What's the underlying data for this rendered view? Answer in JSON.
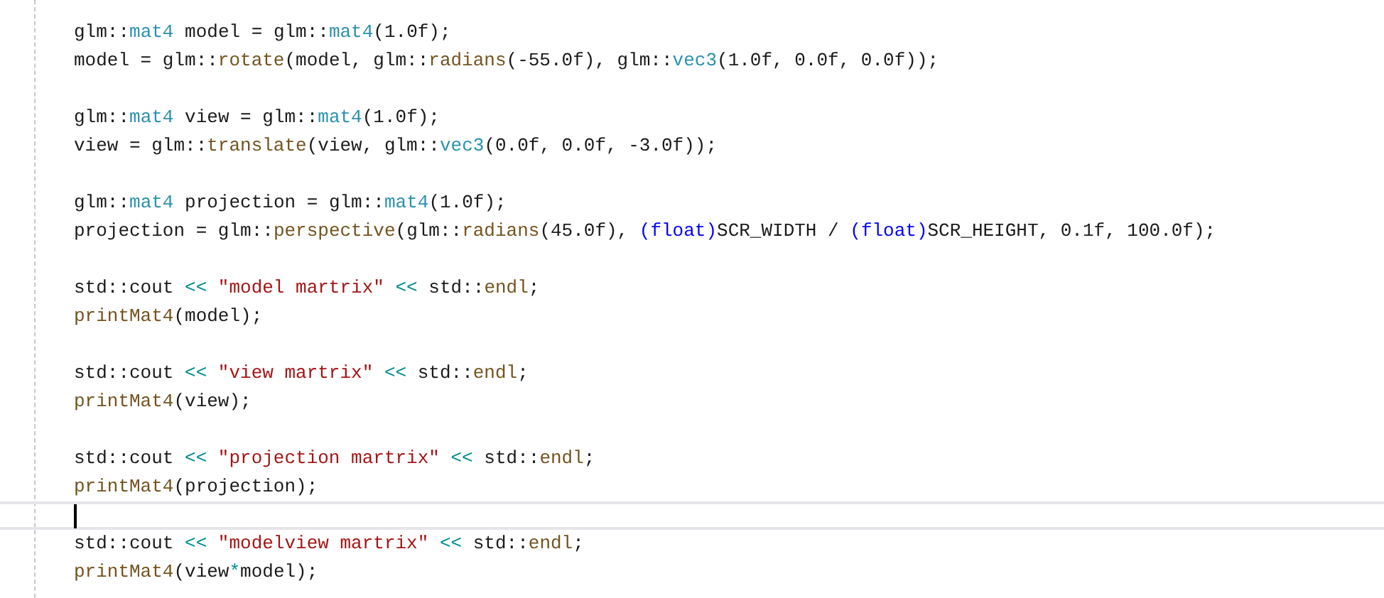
{
  "editor": {
    "lines": [
      {
        "current": false,
        "tokens": [
          {
            "kind": "plain",
            "text": "glm::"
          },
          {
            "kind": "type",
            "text": "mat4"
          },
          {
            "kind": "plain",
            "text": " model = glm::"
          },
          {
            "kind": "type",
            "text": "mat4"
          },
          {
            "kind": "plain",
            "text": "(1.0f);"
          }
        ]
      },
      {
        "current": false,
        "tokens": [
          {
            "kind": "plain",
            "text": "model = glm::"
          },
          {
            "kind": "func",
            "text": "rotate"
          },
          {
            "kind": "plain",
            "text": "(model, glm::"
          },
          {
            "kind": "func",
            "text": "radians"
          },
          {
            "kind": "plain",
            "text": "(-55.0f), glm::"
          },
          {
            "kind": "type",
            "text": "vec3"
          },
          {
            "kind": "plain",
            "text": "(1.0f, 0.0f, 0.0f));"
          }
        ]
      },
      {
        "current": false
      },
      {
        "current": false,
        "tokens": [
          {
            "kind": "plain",
            "text": "glm::"
          },
          {
            "kind": "type",
            "text": "mat4"
          },
          {
            "kind": "plain",
            "text": " view = glm::"
          },
          {
            "kind": "type",
            "text": "mat4"
          },
          {
            "kind": "plain",
            "text": "(1.0f);"
          }
        ]
      },
      {
        "current": false,
        "tokens": [
          {
            "kind": "plain",
            "text": "view = glm::"
          },
          {
            "kind": "func",
            "text": "translate"
          },
          {
            "kind": "plain",
            "text": "(view, glm::"
          },
          {
            "kind": "type",
            "text": "vec3"
          },
          {
            "kind": "plain",
            "text": "(0.0f, 0.0f, -3.0f));"
          }
        ]
      },
      {
        "current": false
      },
      {
        "current": false,
        "tokens": [
          {
            "kind": "plain",
            "text": "glm::"
          },
          {
            "kind": "type",
            "text": "mat4"
          },
          {
            "kind": "plain",
            "text": " projection = glm::"
          },
          {
            "kind": "type",
            "text": "mat4"
          },
          {
            "kind": "plain",
            "text": "(1.0f);"
          }
        ]
      },
      {
        "current": false,
        "tokens": [
          {
            "kind": "plain",
            "text": "projection = glm::"
          },
          {
            "kind": "func",
            "text": "perspective"
          },
          {
            "kind": "plain",
            "text": "(glm::"
          },
          {
            "kind": "func",
            "text": "radians"
          },
          {
            "kind": "plain",
            "text": "(45.0f), "
          },
          {
            "kind": "keyword",
            "text": "(float)"
          },
          {
            "kind": "plain",
            "text": "SCR_WIDTH / "
          },
          {
            "kind": "keyword",
            "text": "(float)"
          },
          {
            "kind": "plain",
            "text": "SCR_HEIGHT, 0.1f, 100.0f);"
          }
        ]
      },
      {
        "current": false
      },
      {
        "current": false,
        "tokens": [
          {
            "kind": "plain",
            "text": "std::cout "
          },
          {
            "kind": "operator",
            "text": "<< "
          },
          {
            "kind": "string",
            "text": "\"model martrix\""
          },
          {
            "kind": "operator",
            "text": " << "
          },
          {
            "kind": "plain",
            "text": "std::"
          },
          {
            "kind": "func",
            "text": "endl"
          },
          {
            "kind": "plain",
            "text": ";"
          }
        ]
      },
      {
        "current": false,
        "tokens": [
          {
            "kind": "func",
            "text": "printMat4"
          },
          {
            "kind": "plain",
            "text": "(model);"
          }
        ]
      },
      {
        "current": false
      },
      {
        "current": false,
        "tokens": [
          {
            "kind": "plain",
            "text": "std::cout "
          },
          {
            "kind": "operator",
            "text": "<< "
          },
          {
            "kind": "string",
            "text": "\"view martrix\""
          },
          {
            "kind": "operator",
            "text": " << "
          },
          {
            "kind": "plain",
            "text": "std::"
          },
          {
            "kind": "func",
            "text": "endl"
          },
          {
            "kind": "plain",
            "text": ";"
          }
        ]
      },
      {
        "current": false,
        "tokens": [
          {
            "kind": "func",
            "text": "printMat4"
          },
          {
            "kind": "plain",
            "text": "(view);"
          }
        ]
      },
      {
        "current": false
      },
      {
        "current": false,
        "tokens": [
          {
            "kind": "plain",
            "text": "std::cout "
          },
          {
            "kind": "operator",
            "text": "<< "
          },
          {
            "kind": "string",
            "text": "\"projection martrix\""
          },
          {
            "kind": "operator",
            "text": " << "
          },
          {
            "kind": "plain",
            "text": "std::"
          },
          {
            "kind": "func",
            "text": "endl"
          },
          {
            "kind": "plain",
            "text": ";"
          }
        ]
      },
      {
        "current": false,
        "tokens": [
          {
            "kind": "func",
            "text": "printMat4"
          },
          {
            "kind": "plain",
            "text": "(projection);"
          }
        ]
      },
      {
        "current": true
      },
      {
        "current": false,
        "tokens": [
          {
            "kind": "plain",
            "text": "std::cout "
          },
          {
            "kind": "operator",
            "text": "<< "
          },
          {
            "kind": "string",
            "text": "\"modelview martrix\""
          },
          {
            "kind": "operator",
            "text": " << "
          },
          {
            "kind": "plain",
            "text": "std::"
          },
          {
            "kind": "func",
            "text": "endl"
          },
          {
            "kind": "plain",
            "text": ";"
          }
        ]
      },
      {
        "current": false,
        "tokens": [
          {
            "kind": "func",
            "text": "printMat4"
          },
          {
            "kind": "plain",
            "text": "(view"
          },
          {
            "kind": "operator",
            "text": "*"
          },
          {
            "kind": "plain",
            "text": "model);"
          }
        ]
      }
    ]
  }
}
